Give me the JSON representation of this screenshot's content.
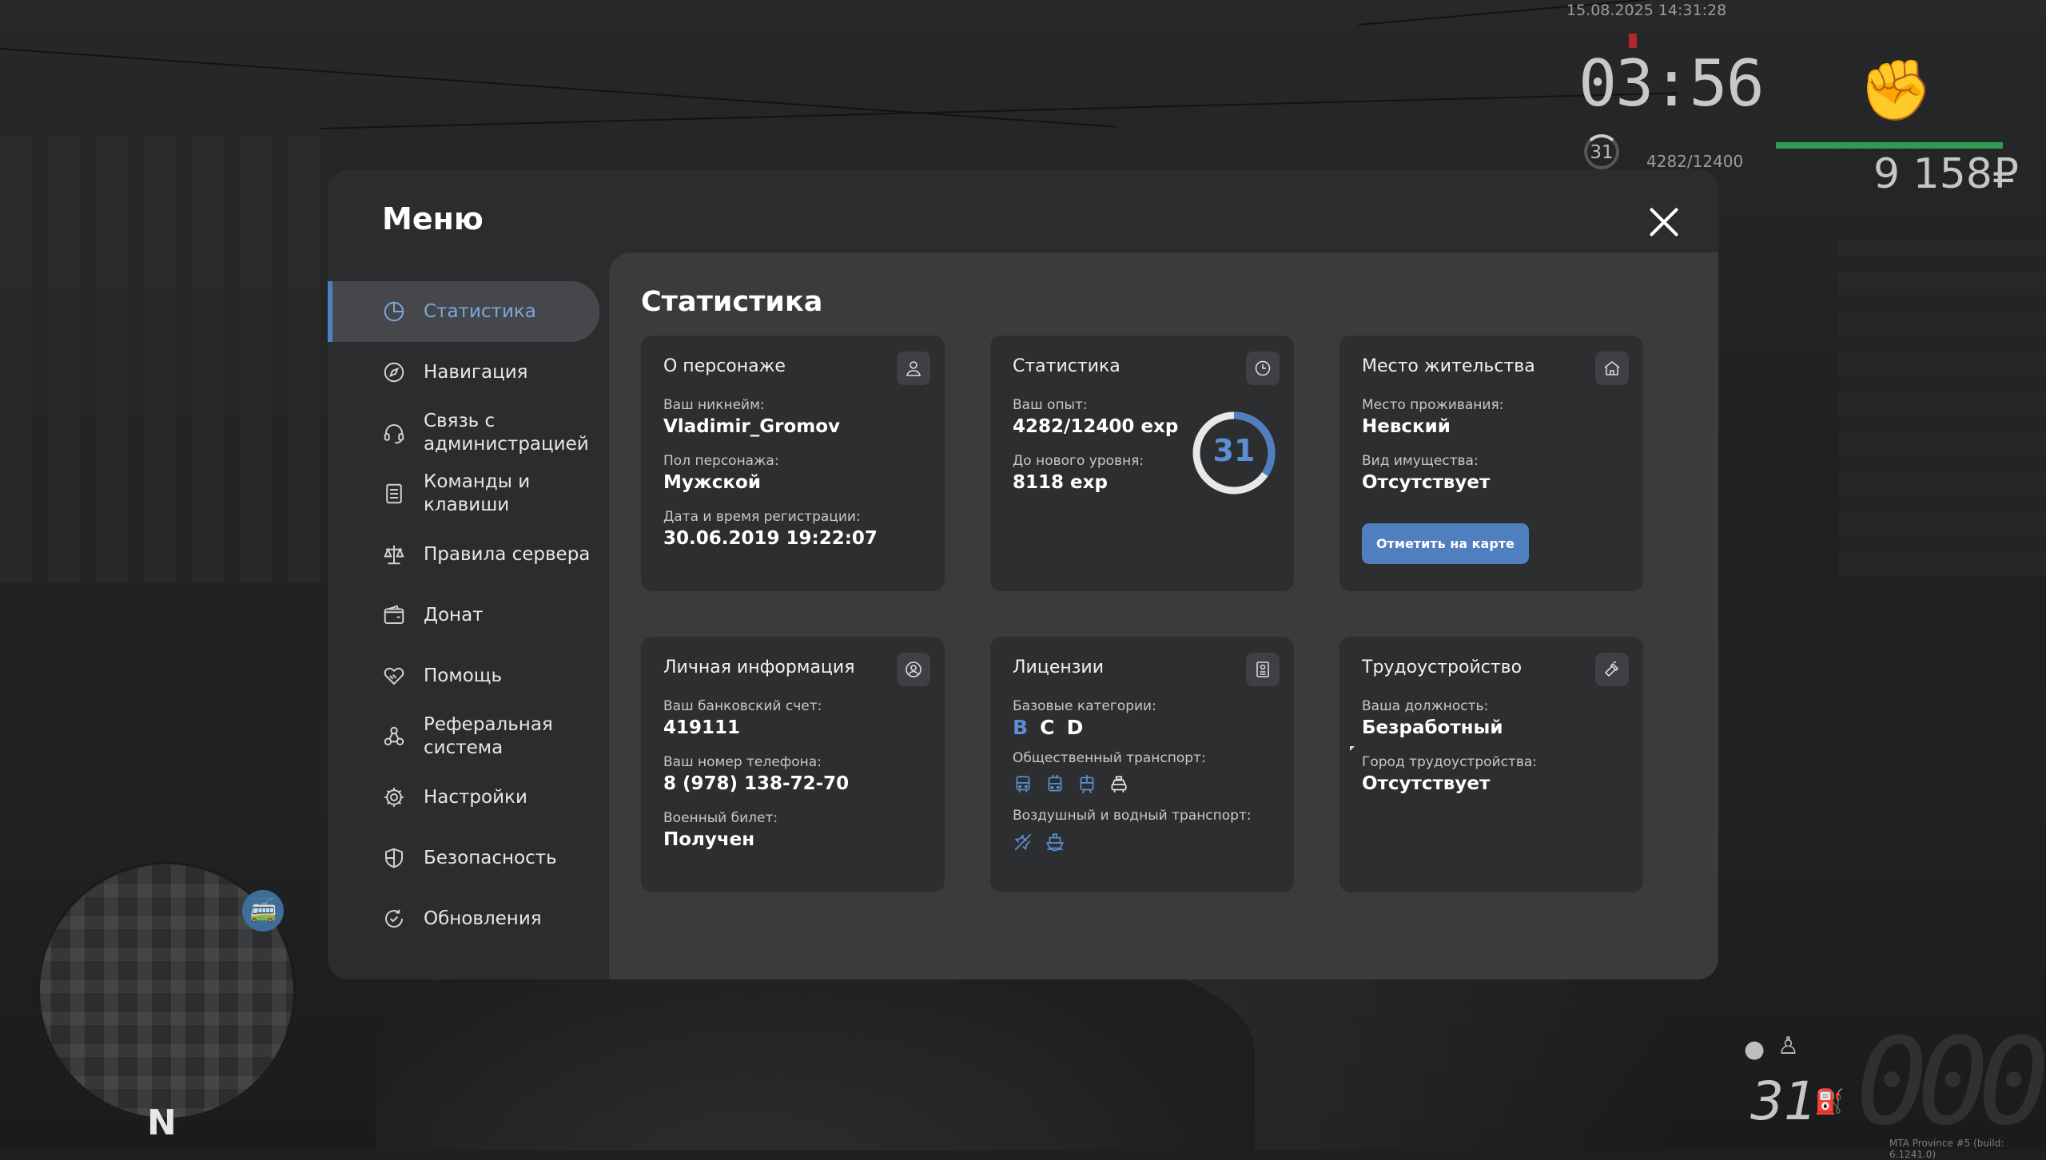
{
  "hud": {
    "datetime": "15.08.2025 14:31:28",
    "clock": "03:56",
    "level": "31",
    "exp": "4282/12400",
    "money": "9 158₽",
    "health_fraction": 1.0,
    "speed": "000",
    "gear": "31",
    "compass": "N",
    "build": "MTA Province #5 (build: 6.1241.0)"
  },
  "menu": {
    "title": "Меню",
    "nav": [
      {
        "label": "Статистика",
        "icon": "pie-chart-icon",
        "active": true
      },
      {
        "label": "Навигация",
        "icon": "compass-icon"
      },
      {
        "label": "Связь с администрацией",
        "icon": "headset-icon"
      },
      {
        "label": "Команды и клавиши",
        "icon": "document-list-icon"
      },
      {
        "label": "Правила сервера",
        "icon": "scales-icon"
      },
      {
        "label": "Донат",
        "icon": "wallet-icon"
      },
      {
        "label": "Помощь",
        "icon": "handshake-heart-icon"
      },
      {
        "label": "Реферальная система",
        "icon": "referral-network-icon"
      },
      {
        "label": "Настройки",
        "icon": "gear-icon"
      },
      {
        "label": "Безопасность",
        "icon": "shield-icon"
      },
      {
        "label": "Обновления",
        "icon": "refresh-check-icon"
      }
    ]
  },
  "content": {
    "title": "Статистика",
    "cards": {
      "character": {
        "title": "О персонаже",
        "nickname_label": "Ваш никнейм:",
        "nickname": "Vladimir_Gromov",
        "gender_label": "Пол персонажа:",
        "gender": "Мужской",
        "reg_label": "Дата и время регистрации:",
        "reg": "30.06.2019 19:22:07"
      },
      "stats": {
        "title": "Статистика",
        "exp_label": "Ваш опыт:",
        "exp": "4282/12400 exp",
        "next_label": "До нового уровня:",
        "next": "8118 exp",
        "level": "31",
        "progress_fraction": 0.345
      },
      "residence": {
        "title": "Место жительства",
        "place_label": "Место проживания:",
        "place": "Невский",
        "property_label": "Вид имущества:",
        "property": "Отсутствует",
        "button": "Отметить на карте"
      },
      "personal": {
        "title": "Личная информация",
        "bank_label": "Ваш банковский счет:",
        "bank": "419111",
        "phone_label": "Ваш номер телефона:",
        "phone": "8 (978) 138-72-70",
        "military_label": "Военный билет:",
        "military": "Получен"
      },
      "licenses": {
        "title": "Лицензии",
        "base_label": "Базовые категории:",
        "categories": [
          {
            "label": "B",
            "owned": true
          },
          {
            "label": "C",
            "owned": false
          },
          {
            "label": "D",
            "owned": false
          }
        ],
        "public_label": "Общественный транспорт:",
        "public_icons": [
          "bus-icon",
          "trolleybus-icon",
          "tram-icon",
          "taxi-icon"
        ],
        "air_label": "Воздушный и водный транспорт:",
        "air_icons": [
          "plane-icon",
          "boat-icon"
        ]
      },
      "job": {
        "title": "Трудоустройство",
        "position_label": "Ваша должность:",
        "position": "Безработный",
        "city_label": "Город трудоустройства:",
        "city": "Отсутствует"
      }
    }
  },
  "colors": {
    "accent": "#4f7fbf",
    "accent_light": "#5b8ed3",
    "card_bg": "#2d2e30",
    "panel_bg": "#3a3b3d",
    "menu_bg": "#2b2c2e"
  }
}
